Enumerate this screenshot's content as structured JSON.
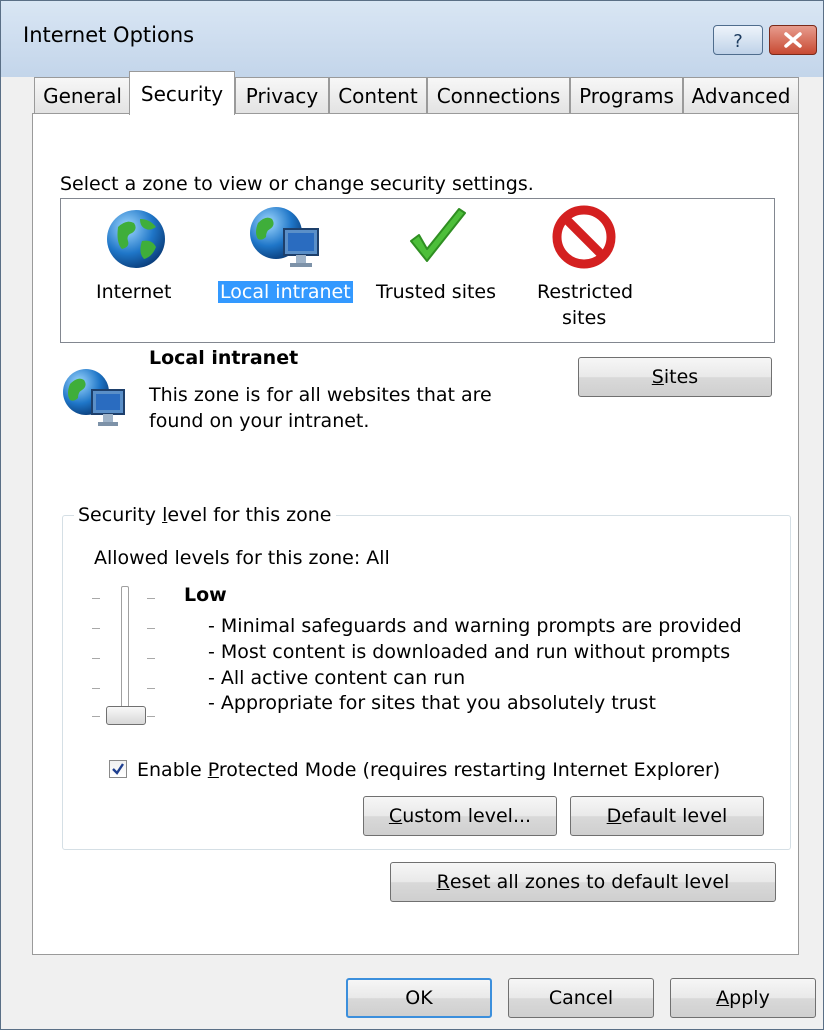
{
  "window": {
    "title": "Internet Options"
  },
  "tabs": [
    {
      "label": "General"
    },
    {
      "label": "Security"
    },
    {
      "label": "Privacy"
    },
    {
      "label": "Content"
    },
    {
      "label": "Connections"
    },
    {
      "label": "Programs"
    },
    {
      "label": "Advanced"
    }
  ],
  "active_tab": "Security",
  "zone_prompt": "Select a zone to view or change security settings.",
  "zones": [
    {
      "label": "Internet",
      "icon": "globe-icon"
    },
    {
      "label": "Local intranet",
      "icon": "intranet-icon"
    },
    {
      "label": "Trusted sites",
      "icon": "checkmark-icon"
    },
    {
      "label_line1": "Restricted",
      "label_line2": "sites",
      "icon": "restricted-icon"
    }
  ],
  "selected_zone": {
    "name": "Local intranet",
    "description_line1": "This zone is for all websites that are",
    "description_line2": "found on your intranet.",
    "sites_button": {
      "pre": "",
      "u": "S",
      "post": "ites"
    }
  },
  "security_level": {
    "group_title": {
      "pre": "Security ",
      "u": "l",
      "post": "evel for this zone"
    },
    "allowed_levels": "Allowed levels for this zone: All",
    "level_name": "Low",
    "level_fraction": 0.0,
    "bullets": [
      "- Minimal safeguards and warning prompts are provided",
      "- Most content is downloaded and run without prompts",
      "- All active content can run",
      "- Appropriate for sites that you absolutely trust"
    ],
    "protected_mode": {
      "checked": true,
      "pre": "Enable ",
      "u": "P",
      "post": "rotected Mode (requires restarting Internet Explorer)"
    },
    "custom_level_button": {
      "pre": "",
      "u": "C",
      "post": "ustom level..."
    },
    "default_level_button": {
      "pre": "",
      "u": "D",
      "post": "efault level"
    }
  },
  "reset_button": {
    "pre": "",
    "u": "R",
    "post": "eset all zones to default level"
  },
  "footer": {
    "ok": "OK",
    "cancel": "Cancel",
    "apply": {
      "pre": "",
      "u": "A",
      "post": "pply"
    }
  },
  "colors": {
    "selection": "#3399ff",
    "default_button_border": "#3c8fdc",
    "title_bar": "#c3d5ea",
    "close_button": "#c84a32"
  }
}
